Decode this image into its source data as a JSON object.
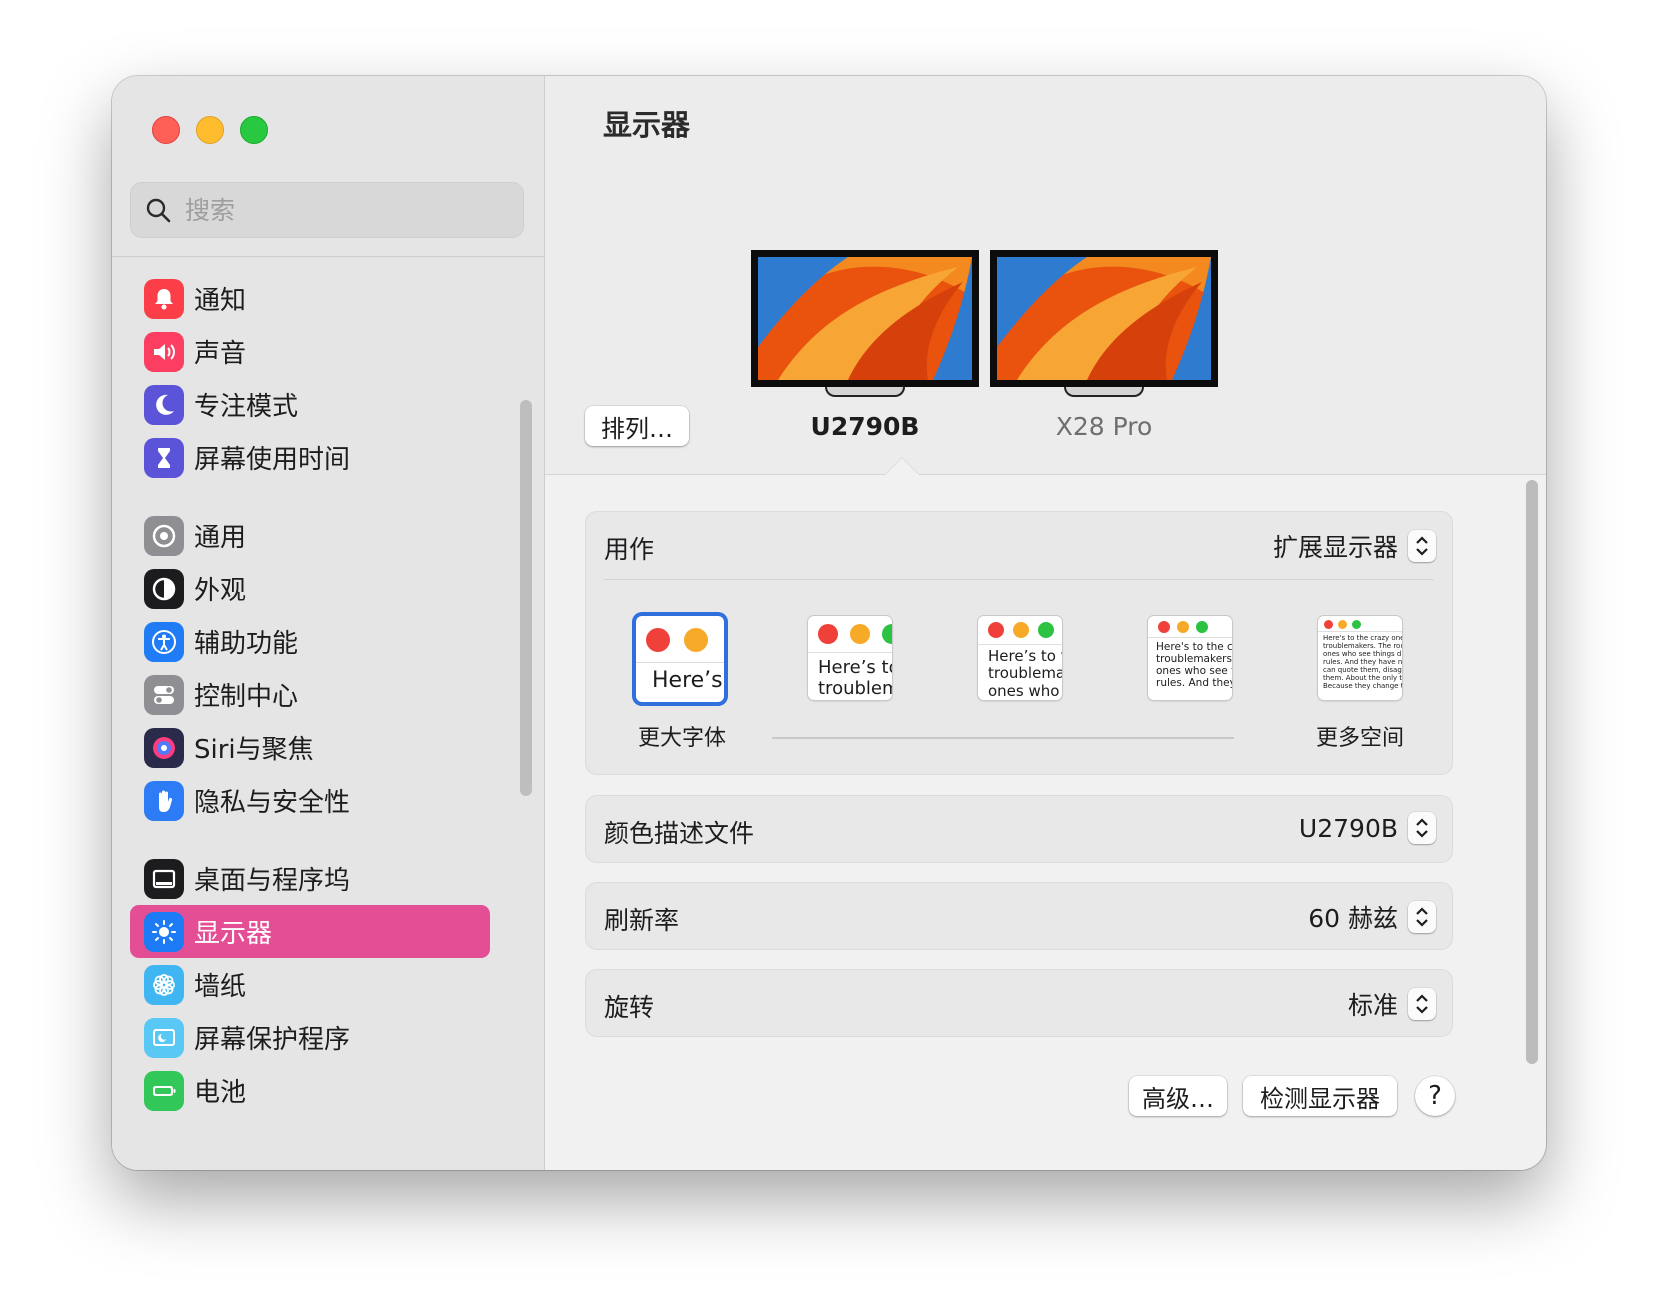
{
  "sidebar": {
    "search_placeholder": "搜索",
    "groups": [
      [
        {
          "label": "通知",
          "icon": "bell-icon",
          "color": "#fb3e47"
        },
        {
          "label": "声音",
          "icon": "speaker-icon",
          "color": "#fb3e62"
        },
        {
          "label": "专注模式",
          "icon": "moon-icon",
          "color": "#5b54d8"
        },
        {
          "label": "屏幕使用时间",
          "icon": "hourglass-icon",
          "color": "#5b54d8"
        }
      ],
      [
        {
          "label": "通用",
          "icon": "gear-icon",
          "color": "#8e8e93"
        },
        {
          "label": "外观",
          "icon": "appearance-icon",
          "color": "#1c1c1e"
        },
        {
          "label": "辅助功能",
          "icon": "accessibility-icon",
          "color": "#1f7cf5"
        },
        {
          "label": "控制中心",
          "icon": "toggles-icon",
          "color": "#8e8e93"
        },
        {
          "label": "Siri与聚焦",
          "icon": "siri-icon",
          "color": "#2a2a4a"
        },
        {
          "label": "隐私与安全性",
          "icon": "hand-icon",
          "color": "#2d7cf6"
        }
      ],
      [
        {
          "label": "桌面与程序坞",
          "icon": "dock-icon",
          "color": "#1c1c1e"
        },
        {
          "label": "显示器",
          "icon": "brightness-icon",
          "color": "#1e7bf6",
          "active": true
        },
        {
          "label": "墙纸",
          "icon": "flower-icon",
          "color": "#3fb6f1"
        },
        {
          "label": "屏幕保护程序",
          "icon": "screensaver-icon",
          "color": "#5ac8f5"
        },
        {
          "label": "电池",
          "icon": "battery-icon",
          "color": "#32c759"
        }
      ]
    ]
  },
  "main": {
    "title": "显示器",
    "arrange_button": "排列…",
    "displays": [
      {
        "name": "U2790B",
        "selected": true
      },
      {
        "name": "X28 Pro",
        "selected": false
      }
    ],
    "use_as": {
      "label": "用作",
      "value": "扩展显示器"
    },
    "resolution_options": [
      {
        "text": "Here’s"
      },
      {
        "text": "Here’s to\ntroublem"
      },
      {
        "text": "Here’s to t\ntroublema\nones who"
      },
      {
        "text": "Here's to the cr\ntroublemakers.\nones who see t\nrules. And they"
      },
      {
        "text": "Here's to the crazy ones\ntroublemakers. The rou\nones who see things dif\nrules. And they have no\ncan quote them, disagre\nthem. About the only th\nBecause they change th"
      }
    ],
    "resolution_caption_left": "更大字体",
    "resolution_caption_right": "更多空间",
    "color_profile": {
      "label": "颜色描述文件",
      "value": "U2790B"
    },
    "refresh_rate": {
      "label": "刷新率",
      "value": "60 赫兹"
    },
    "rotation": {
      "label": "旋转",
      "value": "标准"
    },
    "advanced_button": "高级…",
    "detect_button": "检测显示器",
    "help_button": "?"
  },
  "colors": {
    "accent": "#e34e95",
    "selection_blue": "#2f6fde"
  }
}
